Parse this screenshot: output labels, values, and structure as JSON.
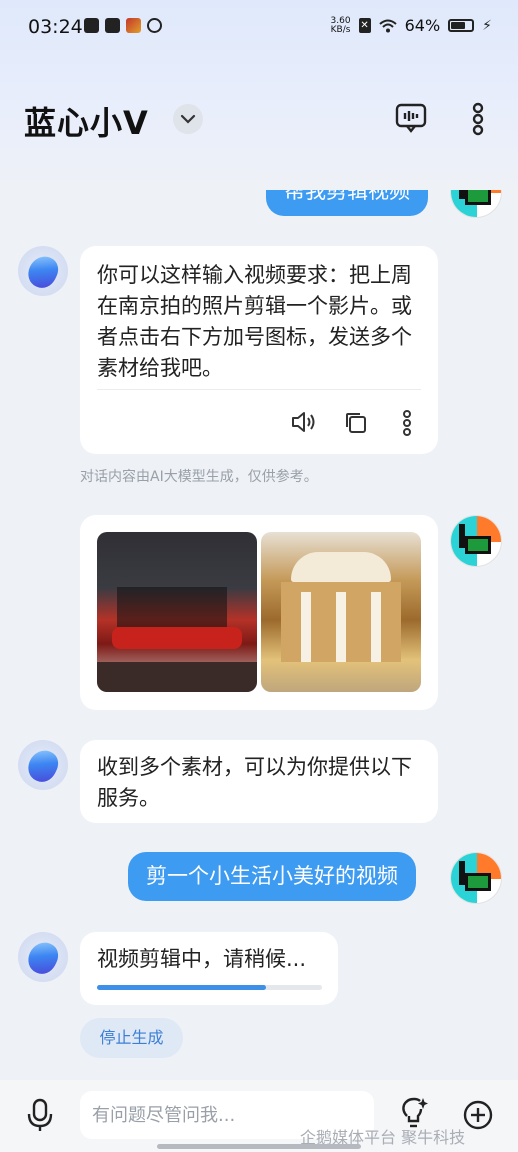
{
  "status_bar": {
    "time": "03:24",
    "net_speed_value": "3.60",
    "net_speed_unit": "KB/s",
    "battery": "64%"
  },
  "header": {
    "title": "蓝心小V"
  },
  "messages": [
    {
      "role": "user",
      "text": "帮我剪辑视频"
    },
    {
      "role": "bot",
      "text": "你可以这样输入视频要求：把上周在南京拍的照片剪辑一个影片。或者点击右下方加号图标，发送多个素材给我吧。"
    },
    {
      "role": "bot",
      "text": "收到多个素材，可以为你提供以下服务。"
    },
    {
      "role": "user",
      "text": "剪一个小生活小美好的视频"
    },
    {
      "role": "bot",
      "text": "视频剪辑中，请稍候..."
    }
  ],
  "disclaimer": "对话内容由AI大模型生成，仅供参考。",
  "progress": {
    "fraction": 0.75
  },
  "stop_button": "停止生成",
  "input": {
    "placeholder": "有问题尽管问我..."
  },
  "watermark": "企鹅媒体平台 聚牛科技",
  "colors": {
    "accent": "#3d9bf2",
    "background": "#eef1f6"
  },
  "icons": [
    "speaker-icon",
    "copy-icon",
    "more-vertical-icon",
    "mic-icon",
    "bulb-icon",
    "plus-circle-icon",
    "message-box-icon",
    "chevron-down-icon"
  ]
}
